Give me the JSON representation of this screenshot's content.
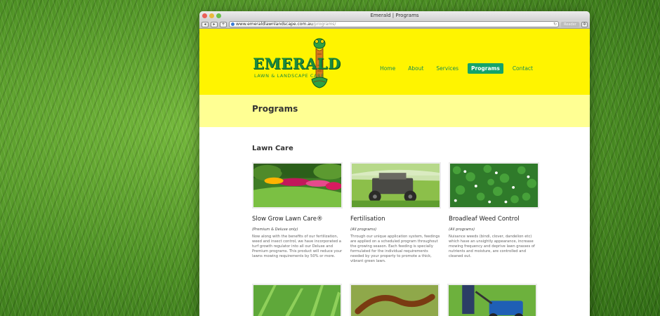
{
  "browser": {
    "window_title": "Emerald | Programs",
    "url_host": "www.emeraldlawnlandscape.com.au",
    "url_path": "/programs/",
    "reader_label": "Reader"
  },
  "site": {
    "logo_text": "EMERALD",
    "logo_subtext": "LAWN & LANDSCAPE CARE",
    "nav": [
      {
        "label": "Home"
      },
      {
        "label": "About"
      },
      {
        "label": "Services"
      },
      {
        "label": "Programs",
        "active": true
      },
      {
        "label": "Contact"
      }
    ],
    "colors": {
      "header": "#fff400",
      "band": "#ffff93",
      "accent": "#14a36a"
    }
  },
  "page": {
    "title": "Programs",
    "section_title": "Lawn Care",
    "cards": [
      {
        "title": "Slow Grow Lawn Care®",
        "tag": "(Premium & Deluxe only)",
        "text": "Now along with the benefits of our fertilization, weed and insect control, we have incorporated a turf growth regulator into all our Deluxe and Premium programs.  This product will reduce your lawns mowing requirements by 50% or more.",
        "image": "garden-lawn-photo"
      },
      {
        "title": "Fertilisation",
        "tag": "(All programs)",
        "text": "Through our unique application system, feedings are applied on a scheduled program throughout the growing season.  Each feeding is specially formulated for the individual requirements needed by your property to promote a thick, vibrant green lawn.",
        "image": "spreader-machine-photo"
      },
      {
        "title": "Broadleaf Weed Control",
        "tag": "(All programs)",
        "text": "Nuisance weeds (bindi, clover, dandelion etc) which have an unsightly appearance, increase mowing frequency and deprive lawn grasses of nutrients and moisture, are controlled and cleaned out.",
        "image": "clover-photo"
      }
    ],
    "row2_images": [
      "grass-blades-photo",
      "caterpillar-photo",
      "lawn-mower-photo"
    ]
  }
}
